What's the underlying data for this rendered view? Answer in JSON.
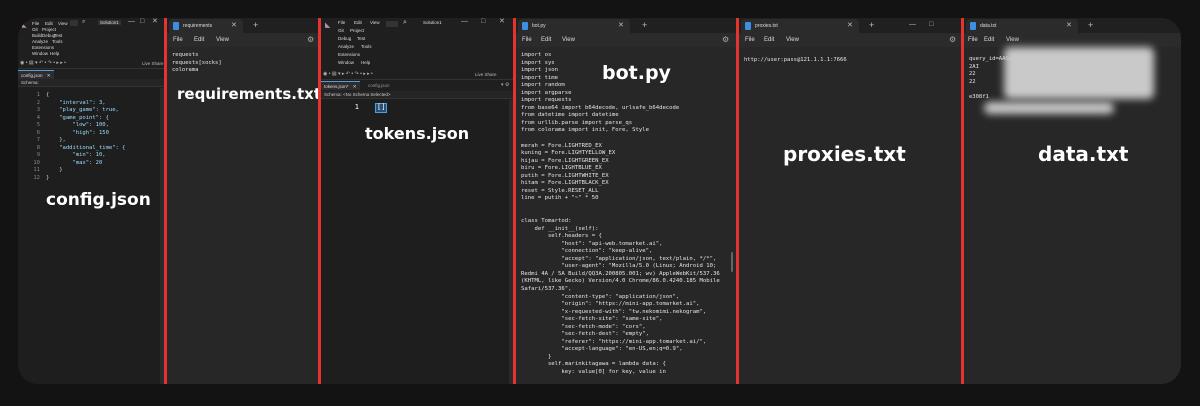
{
  "config_panel": {
    "caption": "config.json",
    "menu": [
      "File",
      "Edit",
      "View",
      "Git",
      "Project",
      "Build",
      "Debug",
      "Test",
      "Analyze",
      "Tools",
      "Extensions",
      "Window",
      "Help"
    ],
    "solution_label": "Solution1",
    "live_share": "Live Share",
    "doc_tab": "config.json",
    "schema": "Schema:",
    "line_numbers": "1\n2\n3\n4\n5\n6\n7\n8\n9\n10\n11\n12",
    "code_text": "{\n    \"interval\": 3,\n    \"play_game\": true,\n    \"game_point\": {\n        \"low\": 100,\n        \"high\": 150\n    },\n    \"additional_time\": {\n        \"min\": 10,\n        \"max\": 20\n    }\n}"
  },
  "requirements_panel": {
    "caption": "requirements.txt",
    "tab_title": "requirements",
    "menu": {
      "file": "File",
      "edit": "Edit",
      "view": "View"
    },
    "content": "requests\nrequests[socks]\ncolorama"
  },
  "tokens_panel": {
    "caption": "tokens.json",
    "menu": [
      "File",
      "Edit",
      "View",
      "Git",
      "Project",
      "Debug",
      "Test",
      "Analyze",
      "Tools",
      "Extensions",
      "Window",
      "Help"
    ],
    "solution_label": "Solution1",
    "live_share": "Live Share",
    "doc_tab_active": "tokens.json*",
    "doc_tab_inactive": "config.json",
    "schema": "Schema: <No Schema Selected>",
    "line_number": "1",
    "code": "[]"
  },
  "bot_panel": {
    "caption": "bot.py",
    "tab_title": "bot.py",
    "menu": {
      "file": "File",
      "edit": "Edit",
      "view": "View"
    },
    "content": "import os\nimport sys\nimport json\nimport time\nimport random\nimport argparse\nimport requests\nfrom base64 import b64decode, urlsafe_b64decode\nfrom datetime import datetime\nfrom urllib.parse import parse_qs\nfrom colorama import init, Fore, Style\n\nmerah = Fore.LIGHTRED_EX\nkuning = Fore.LIGHTYELLOW_EX\nhijau = Fore.LIGHTGREEN_EX\nbiru = Fore.LIGHTBLUE_EX\nputih = Fore.LIGHTWHITE_EX\nhitam = Fore.LIGHTBLACK_EX\nreset = Style.RESET_ALL\nline = putih + \"~\" * 50\n\n\nclass Tomartod:\n    def __init__(self):\n        self.headers = {\n            \"host\": \"api-web.tomarket.ai\",\n            \"connection\": \"keep-alive\",\n            \"accept\": \"application/json, text/plain, */*\",\n            \"user-agent\": \"Mozilla/5.0 (Linux; Android 10;\nRedmi 4A / 5A Build/QQ3A.200805.001; wv) AppleWebKit/537.36\n(KHTML, like Gecko) Version/4.0 Chrome/86.0.4240.185 Mobile\nSafari/537.36\",\n            \"content-type\": \"application/json\",\n            \"origin\": \"https://mini-app.tomarket.ai\",\n            \"x-requested-with\": \"tw.nekomimi.nekogram\",\n            \"sec-fetch-site\": \"same-site\",\n            \"sec-fetch-mode\": \"cors\",\n            \"sec-fetch-dest\": \"empty\",\n            \"referer\": \"https://mini-app.tomarket.ai/\",\n            \"accept-language\": \"en-US,en;q=0.9\",\n        }\n        self.marinkitagawa = lambda data: {\n            key: value[0] for key, value in"
  },
  "proxies_panel": {
    "caption": "proxies.txt",
    "tab_title": "proxies.txt",
    "menu": {
      "file": "File",
      "edit": "Edit",
      "view": "View"
    },
    "content": "http://user:pass@121.1.1.1:7666"
  },
  "data_panel": {
    "caption": "data.txt",
    "tab_title": "data.txt",
    "menu": {
      "file": "File",
      "edit": "Edit",
      "view": "View"
    },
    "content": "query_id=AAGaIT83\n2AI\n22\n22\n\ne308f1"
  }
}
